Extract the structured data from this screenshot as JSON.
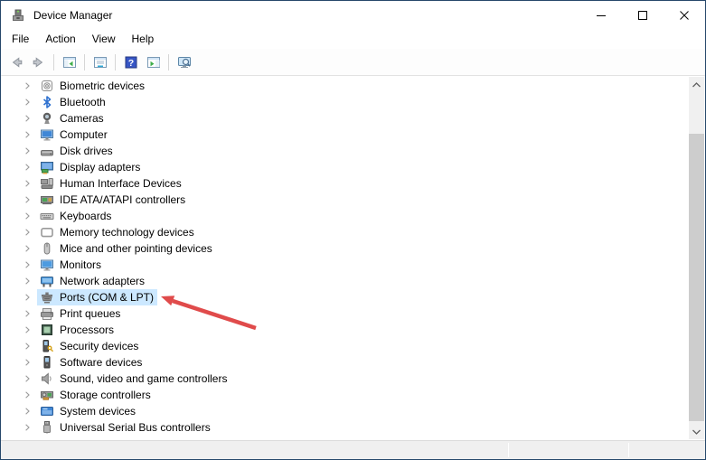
{
  "window": {
    "title": "Device Manager",
    "icon": "device-manager-app-icon"
  },
  "menu_bar": {
    "items": [
      "File",
      "Action",
      "View",
      "Help"
    ]
  },
  "toolbar": {
    "buttons": [
      {
        "name": "back-button",
        "icon": "back-arrow-icon",
        "divider_after": false
      },
      {
        "name": "forward-button",
        "icon": "forward-arrow-icon",
        "divider_after": true
      },
      {
        "name": "show-hide-console-tree-button",
        "icon": "console-tree-icon",
        "divider_after": true
      },
      {
        "name": "properties-button",
        "icon": "properties-icon",
        "divider_after": true
      },
      {
        "name": "help-button",
        "icon": "help-icon",
        "divider_after": false
      },
      {
        "name": "show-hide-action-pane-button",
        "icon": "action-pane-icon",
        "divider_after": true
      },
      {
        "name": "scan-hardware-changes-button",
        "icon": "scan-hardware-icon",
        "divider_after": false
      }
    ]
  },
  "tree": {
    "items": [
      {
        "label": "Biometric devices",
        "icon": "fingerprint-icon",
        "selected": false
      },
      {
        "label": "Bluetooth",
        "icon": "bluetooth-icon",
        "selected": false
      },
      {
        "label": "Cameras",
        "icon": "camera-icon",
        "selected": false
      },
      {
        "label": "Computer",
        "icon": "computer-icon",
        "selected": false
      },
      {
        "label": "Disk drives",
        "icon": "disk-drive-icon",
        "selected": false
      },
      {
        "label": "Display adapters",
        "icon": "display-adapter-icon",
        "selected": false
      },
      {
        "label": "Human Interface Devices",
        "icon": "hid-icon",
        "selected": false
      },
      {
        "label": "IDE ATA/ATAPI controllers",
        "icon": "ide-controller-icon",
        "selected": false
      },
      {
        "label": "Keyboards",
        "icon": "keyboard-icon",
        "selected": false
      },
      {
        "label": "Memory technology devices",
        "icon": "memory-device-icon",
        "selected": false
      },
      {
        "label": "Mice and other pointing devices",
        "icon": "mouse-icon",
        "selected": false
      },
      {
        "label": "Monitors",
        "icon": "monitor-icon",
        "selected": false
      },
      {
        "label": "Network adapters",
        "icon": "network-adapter-icon",
        "selected": false
      },
      {
        "label": "Ports (COM & LPT)",
        "icon": "serial-port-icon",
        "selected": true
      },
      {
        "label": "Print queues",
        "icon": "printer-icon",
        "selected": false
      },
      {
        "label": "Processors",
        "icon": "processor-icon",
        "selected": false
      },
      {
        "label": "Security devices",
        "icon": "security-device-icon",
        "selected": false
      },
      {
        "label": "Software devices",
        "icon": "software-device-icon",
        "selected": false
      },
      {
        "label": "Sound, video and game controllers",
        "icon": "speaker-icon",
        "selected": false
      },
      {
        "label": "Storage controllers",
        "icon": "storage-controller-icon",
        "selected": false
      },
      {
        "label": "System devices",
        "icon": "system-device-icon",
        "selected": false
      },
      {
        "label": "Universal Serial Bus controllers",
        "icon": "usb-icon",
        "selected": false
      }
    ]
  },
  "annotation": {
    "type": "arrow",
    "color": "#e04b4b",
    "points_to": "Ports (COM & LPT)"
  },
  "status_bar": {
    "text": ""
  },
  "colors": {
    "selection_highlight": "#cce8ff",
    "window_border": "#26486b",
    "help_icon_blue": "#3756c5",
    "bluetooth_blue": "#2f72d0"
  }
}
